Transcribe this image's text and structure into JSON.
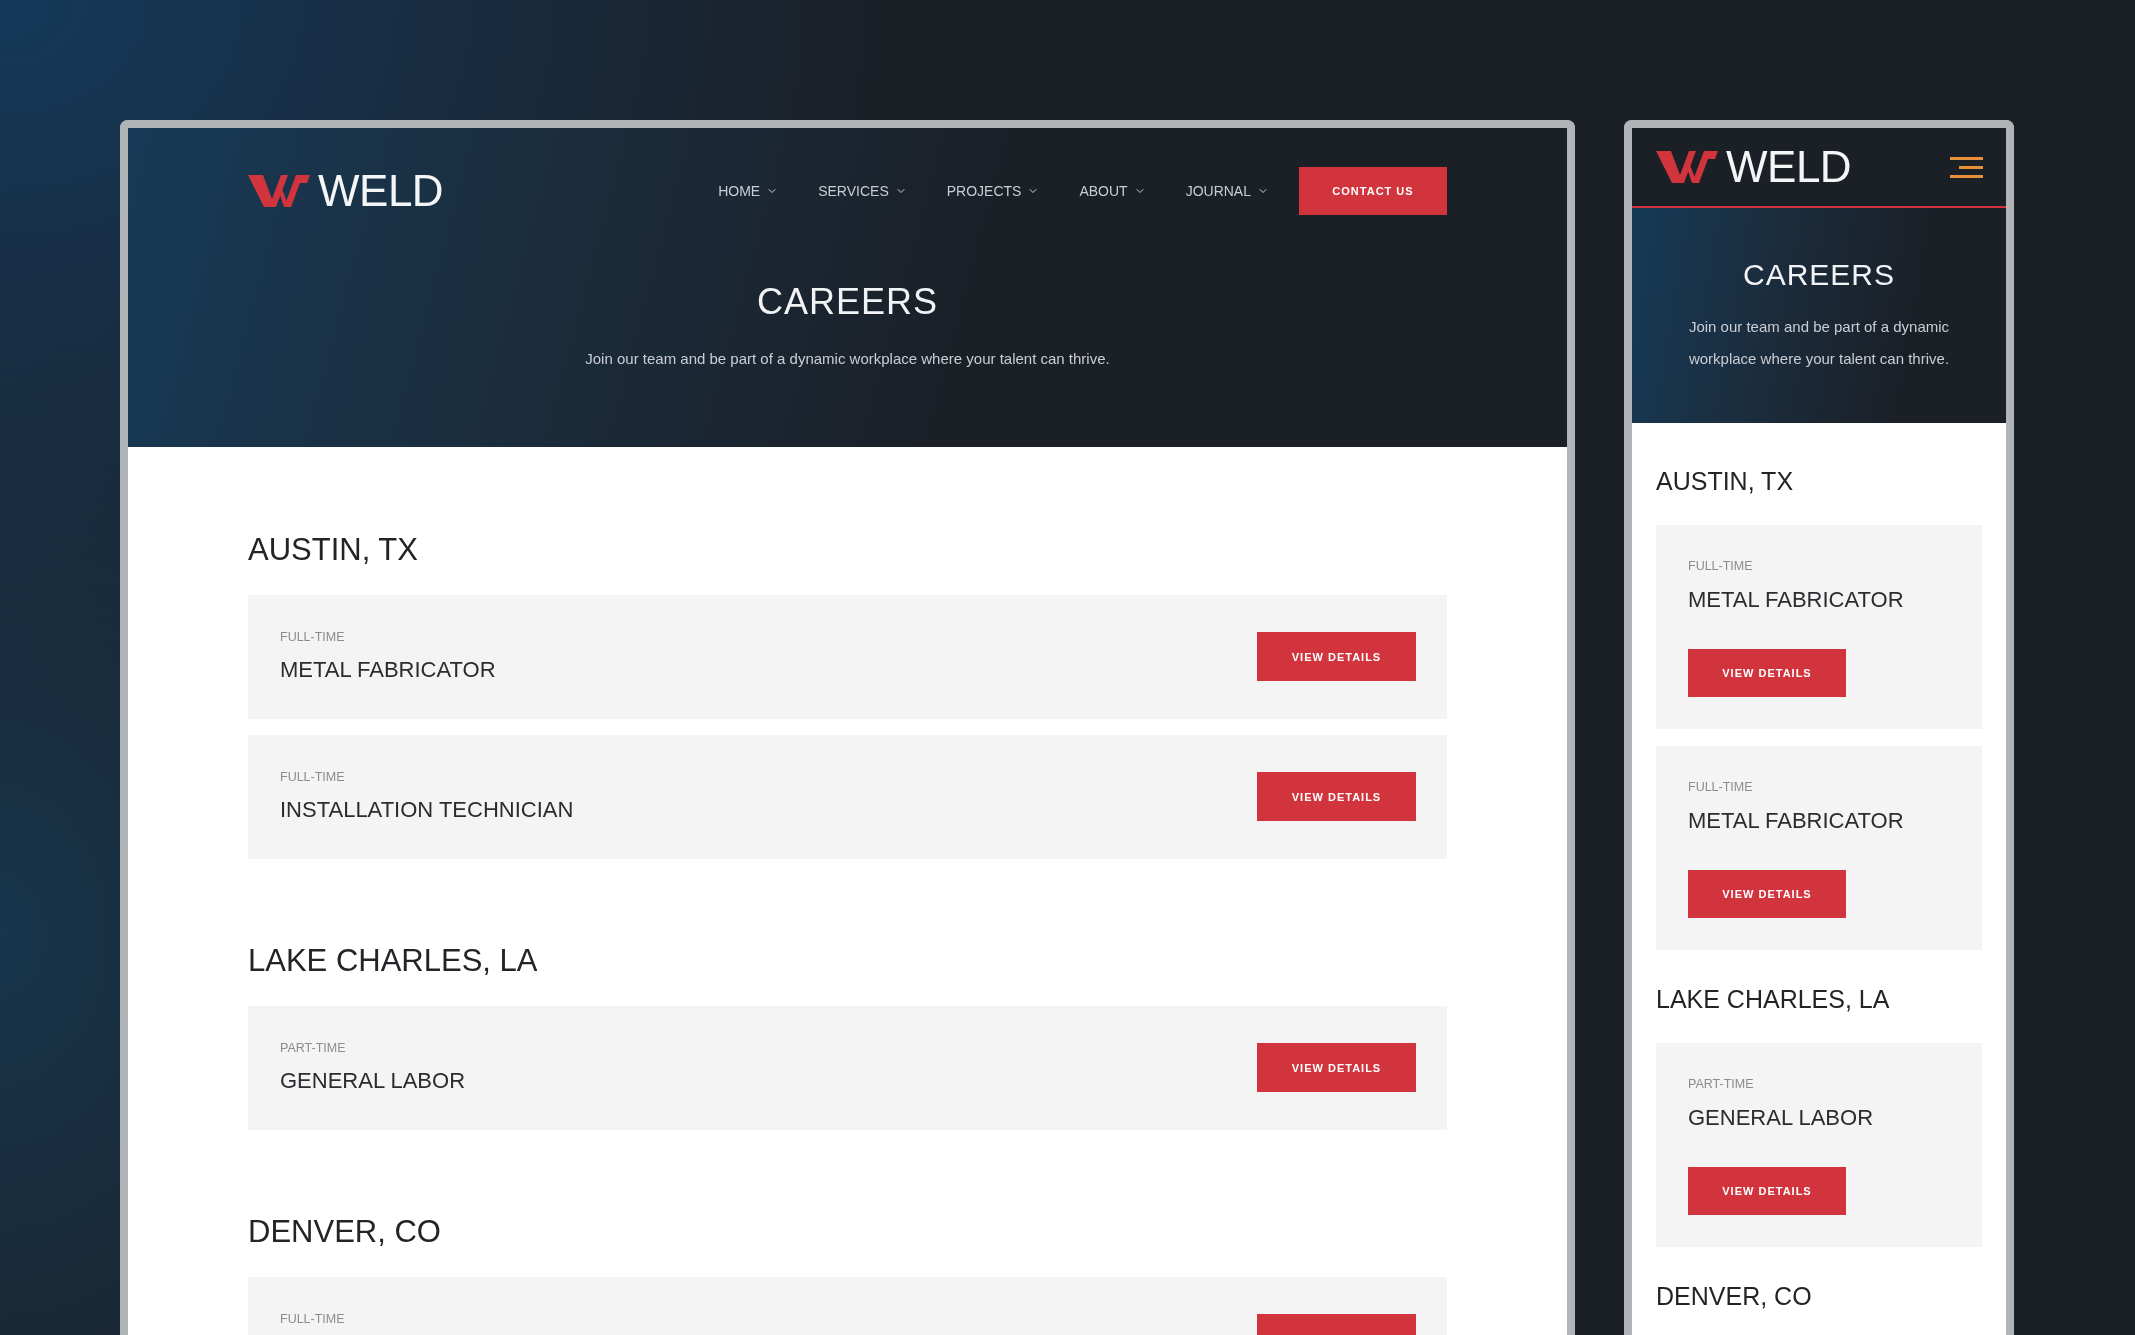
{
  "desktop": {
    "logo": "WELD",
    "nav": [
      {
        "label": "HOME",
        "dropdown": true
      },
      {
        "label": "SERVICES",
        "dropdown": true
      },
      {
        "label": "PROJECTS",
        "dropdown": true
      },
      {
        "label": "ABOUT",
        "dropdown": true
      },
      {
        "label": "JOURNAL",
        "dropdown": true
      }
    ],
    "cta": "CONTACT US",
    "hero": {
      "title": "CAREERS",
      "subtitle": "Join our team and be part of a dynamic workplace where your talent can thrive."
    },
    "locations": [
      {
        "name": "AUSTIN, TX",
        "jobs": [
          {
            "type": "FULL-TIME",
            "title": "METAL FABRICATOR",
            "button": "VIEW DETAILS"
          },
          {
            "type": "FULL-TIME",
            "title": "INSTALLATION TECHNICIAN",
            "button": "VIEW DETAILS"
          }
        ]
      },
      {
        "name": "LAKE CHARLES, LA",
        "jobs": [
          {
            "type": "PART-TIME",
            "title": "GENERAL LABOR",
            "button": "VIEW DETAILS"
          }
        ]
      },
      {
        "name": "DENVER, CO",
        "jobs": [
          {
            "type": "FULL-TIME"
          }
        ]
      }
    ]
  },
  "mobile": {
    "logo": "WELD",
    "hero": {
      "title": "CAREERS",
      "subtitle": "Join our team and be part of a dynamic workplace where your talent can thrive."
    },
    "locations": [
      {
        "name": "AUSTIN, TX",
        "jobs": [
          {
            "type": "FULL-TIME",
            "title": "METAL FABRICATOR",
            "button": "VIEW DETAILS"
          },
          {
            "type": "FULL-TIME",
            "title": "METAL FABRICATOR",
            "button": "VIEW DETAILS"
          }
        ]
      },
      {
        "name": "LAKE CHARLES, LA",
        "jobs": [
          {
            "type": "PART-TIME",
            "title": "GENERAL LABOR",
            "button": "VIEW DETAILS"
          }
        ]
      },
      {
        "name": "DENVER, CO"
      }
    ]
  }
}
